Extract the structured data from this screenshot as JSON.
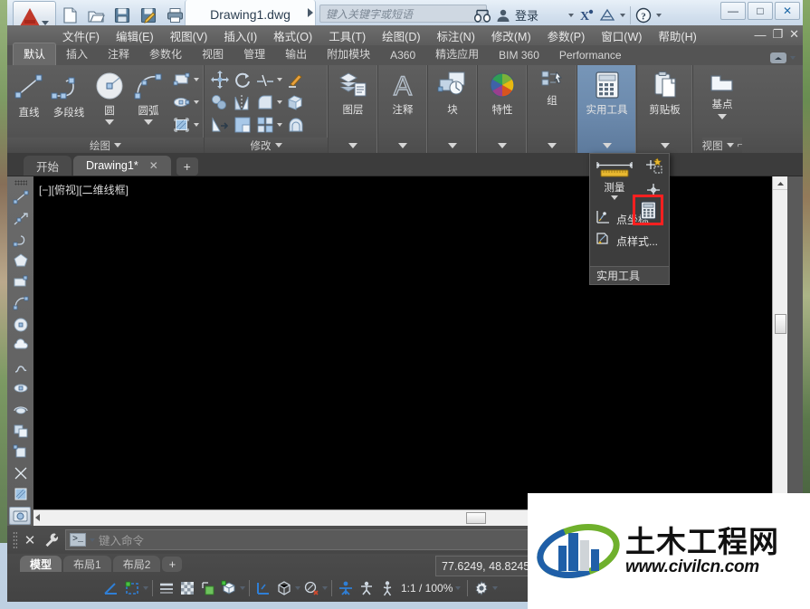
{
  "window": {
    "document_tab": "Drawing1.dwg",
    "search_placeholder": "键入关键字或短语",
    "signin_label": "登录",
    "minimize": "—",
    "maximize": "□",
    "close": "✕"
  },
  "quick_access": [
    {
      "name": "new-file-icon",
      "label": "新建"
    },
    {
      "name": "open-file-icon",
      "label": "打开"
    },
    {
      "name": "save-icon",
      "label": "保存"
    },
    {
      "name": "save-as-icon",
      "label": "另存为"
    },
    {
      "name": "print-icon",
      "label": "打印"
    },
    {
      "name": "more-commands-icon",
      "label": "▸▸"
    }
  ],
  "menubar": {
    "items": [
      "文件(F)",
      "编辑(E)",
      "视图(V)",
      "插入(I)",
      "格式(O)",
      "工具(T)",
      "绘图(D)",
      "标注(N)",
      "修改(M)",
      "参数(P)",
      "窗口(W)",
      "帮助(H)"
    ],
    "win_minimize": "—",
    "win_restore": "❐",
    "win_close": "✕"
  },
  "ribbon_tabs": {
    "items": [
      "默认",
      "插入",
      "注释",
      "参数化",
      "视图",
      "管理",
      "输出",
      "附加模块",
      "A360",
      "精选应用",
      "BIM 360",
      "Performance"
    ],
    "active_index": 0
  },
  "ribbon_panels": [
    {
      "title": "绘图",
      "big_buttons": [
        {
          "name": "line-tool",
          "label": "直线"
        },
        {
          "name": "polyline-tool",
          "label": "多段线"
        },
        {
          "name": "circle-tool",
          "label": "圆",
          "has_caret": true
        },
        {
          "name": "arc-tool",
          "label": "圆弧",
          "has_caret": true
        }
      ],
      "small_buttons": [
        {
          "name": "rectangle-tool",
          "label": "矩形"
        },
        {
          "name": "ellipse-tool",
          "label": "椭圆"
        },
        {
          "name": "hatch-tool",
          "label": "图案填充"
        }
      ]
    },
    {
      "title": "修改",
      "small_buttons": [
        {
          "name": "move-tool",
          "label": "移动"
        },
        {
          "name": "rotate-tool",
          "label": "旋转"
        },
        {
          "name": "trim-tool",
          "label": "修剪"
        },
        {
          "name": "match-properties-tool",
          "label": "特性匹配"
        },
        {
          "name": "copy-tool",
          "label": "复制"
        },
        {
          "name": "mirror-tool",
          "label": "镜像"
        },
        {
          "name": "fillet-tool",
          "label": "圆角"
        },
        {
          "name": "explode-tool",
          "label": "分解"
        },
        {
          "name": "stretch-tool",
          "label": "拉伸"
        },
        {
          "name": "scale-tool",
          "label": "缩放"
        },
        {
          "name": "array-tool",
          "label": "阵列"
        },
        {
          "name": "offset-tool",
          "label": "偏移"
        }
      ]
    },
    {
      "title": "图层",
      "label": "图层",
      "vertical": true
    },
    {
      "title": "注释",
      "label": "注释",
      "vertical": true
    },
    {
      "title": "块",
      "label": "块",
      "vertical": true
    },
    {
      "title": "特性",
      "label": "特性",
      "vertical": true
    },
    {
      "title": "组",
      "label": "组",
      "vertical": true
    },
    {
      "title": "实用工具",
      "label": "实用工具",
      "vertical": true,
      "active": true
    },
    {
      "title": "剪贴板",
      "label": "剪贴板",
      "vertical": true
    },
    {
      "title": "视图",
      "label": "基点",
      "vertical": true
    }
  ],
  "ribbon_panel_titles": {
    "draw": "绘图",
    "modify": "修改",
    "layers": "图层",
    "annotation": "注释",
    "block": "块",
    "properties": "特性",
    "group": "组",
    "utilities": "实用工具",
    "clipboard": "剪贴板",
    "view": "视图"
  },
  "utilities_flyout": {
    "measure_label": "测量",
    "items": [
      {
        "name": "quick-calc-icon",
        "label": "",
        "highlighted": true
      },
      {
        "name": "point-coordinate-item",
        "label": "点坐标"
      },
      {
        "name": "point-style-item",
        "label": "点样式..."
      }
    ],
    "footer": "实用工具",
    "highlight_color": "#ff2020"
  },
  "file_tabs": {
    "start_tab": "开始",
    "drawing_tab": "Drawing1*",
    "close_glyph": "✕",
    "new_tab_glyph": "+"
  },
  "canvas": {
    "viewport_label": "[−][俯视][二维线框]",
    "background": "#000000"
  },
  "command_line": {
    "close_glyph": "✕",
    "prompt_glyph": ">_",
    "placeholder": "键入命令"
  },
  "status_bar": {
    "layout_tabs": [
      "模型",
      "布局1",
      "布局2"
    ],
    "active_layout_index": 0,
    "new_layout_glyph": "+",
    "coordinates": "77.6249, 48.8245",
    "scale": "1:1 / 100%",
    "icons": [
      {
        "name": "ortho-mode-icon"
      },
      {
        "name": "snap-mode-icon"
      },
      {
        "name": "snap-dropdown-caret"
      },
      {
        "name": "lineweight-icon"
      },
      {
        "name": "transparency-icon"
      },
      {
        "name": "selection-cycling-icon"
      },
      {
        "name": "3d-object-snap-icon"
      },
      {
        "name": "3d-snap-caret"
      },
      {
        "name": "ucs-icon"
      },
      {
        "name": "isolate-objects-icon"
      },
      {
        "name": "isolate-caret"
      },
      {
        "name": "annotation-visibility-icon"
      },
      {
        "name": "annotation-caret"
      },
      {
        "name": "workspace-icon"
      },
      {
        "name": "annotation-scale-icon"
      },
      {
        "name": "annotation-monitor-icon"
      },
      {
        "name": "gear-icon"
      },
      {
        "name": "customization-caret"
      }
    ]
  },
  "watermark": {
    "chinese": "土木工程网",
    "url": "www.civilcn.com",
    "green": "#6fb02c",
    "blue": "#1f5fa8"
  }
}
